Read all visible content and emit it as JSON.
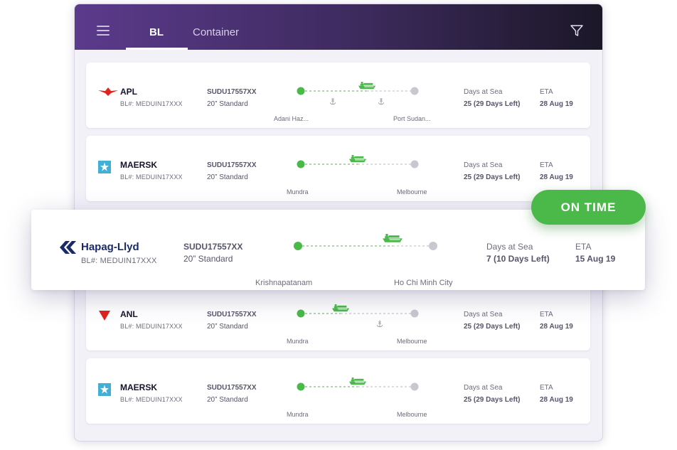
{
  "tabs": {
    "bl": "BL",
    "container": "Container"
  },
  "colors": {
    "accent_green": "#4bb94a",
    "header_purple": "#5b3a8c",
    "apl_red": "#e0231c",
    "maersk_blue": "#42b0d5",
    "hapag_navy": "#1b2a6b"
  },
  "status_badge": "ON TIME",
  "shipments": [
    {
      "carrier": "APL",
      "logo": "apl-logo-icon",
      "bl": "BL#: MEDUIN17XXX",
      "container_id": "SUDU17557XX",
      "container_type": "20” Standard",
      "origin": "Adani Haz...",
      "destination": "Port Sudan...",
      "days_label": "Days at Sea",
      "days_value": "25 (29 Days Left)",
      "eta_label": "ETA",
      "eta_value": "28 Aug 19",
      "progress": 0.58
    },
    {
      "carrier": "MAERSK",
      "logo": "maersk-star-icon",
      "bl": "BL#: MEDUIN17XXX",
      "container_id": "SUDU17557XX",
      "container_type": "20” Standard",
      "origin": "Mundra",
      "destination": "Melbourne",
      "days_label": "Days at Sea",
      "days_value": "25 (29 Days Left)",
      "eta_label": "ETA",
      "eta_value": "28 Aug 19",
      "progress": 0.5
    },
    {
      "carrier": "Hapag-Llyd",
      "logo": "hapag-lloyd-logo-icon",
      "bl": "BL#: MEDUIN17XXX",
      "container_id": "SUDU17557XX",
      "container_type": "20” Standard",
      "origin": "Krishnapatanam",
      "destination": "Ho Chi Minh City",
      "days_label": "Days at Sea",
      "days_value": "7 (10 Days Left)",
      "eta_label": "ETA",
      "eta_value": "15 Aug 19",
      "progress": 0.7
    },
    {
      "carrier": "ANL",
      "logo": "anl-triangle-icon",
      "bl": "BL#: MEDUIN17XXX",
      "container_id": "SUDU17557XX",
      "container_type": "20” Standard",
      "origin": "Mundra",
      "destination": "Melbourne",
      "days_label": "Days at Sea",
      "days_value": "25 (29 Days Left)",
      "eta_label": "ETA",
      "eta_value": "28 Aug 19",
      "progress": 0.35
    },
    {
      "carrier": "MAERSK",
      "logo": "maersk-star-icon",
      "bl": "BL#: MEDUIN17XXX",
      "container_id": "SUDU17557XX",
      "container_type": "20” Standard",
      "origin": "Mundra",
      "destination": "Melbourne",
      "days_label": "Days at Sea",
      "days_value": "25 (29 Days Left)",
      "eta_label": "ETA",
      "eta_value": "28 Aug 19",
      "progress": 0.5
    }
  ]
}
